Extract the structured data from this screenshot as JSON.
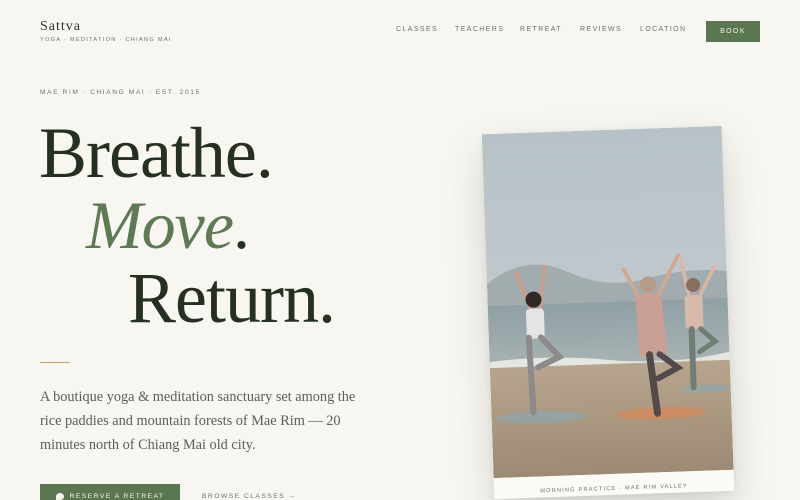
{
  "brand": {
    "name": "Sattva",
    "tagline": "YOGA · MEDITATION · CHIANG MAI"
  },
  "nav": {
    "items": [
      "CLASSES",
      "TEACHERS",
      "RETREAT",
      "REVIEWS",
      "LOCATION"
    ],
    "book_label": "BOOK"
  },
  "hero": {
    "eyebrow": "MAE RIM · CHIANG MAI · EST. 2015",
    "line1": "Breathe.",
    "line2": "Move",
    "line2_dot": ".",
    "line3": "Return.",
    "lede": "A boutique yoga & meditation sanctuary set among the rice paddies and mountain forests of Mae Rim — 20 minutes north of Chiang Mai old city.",
    "cta_label": "RESERVE A RETREAT",
    "browse_label": "BROWSE CLASSES →"
  },
  "photo": {
    "caption": "MORNING PRACTICE · MAE RIM VALLEY"
  },
  "colors": {
    "background": "#f7f6f1",
    "accent_green": "#5b7752",
    "headline": "#263022",
    "rule_gold": "#c8a46a"
  },
  "icons": {
    "cta_icon": "chat-bubble-icon"
  }
}
